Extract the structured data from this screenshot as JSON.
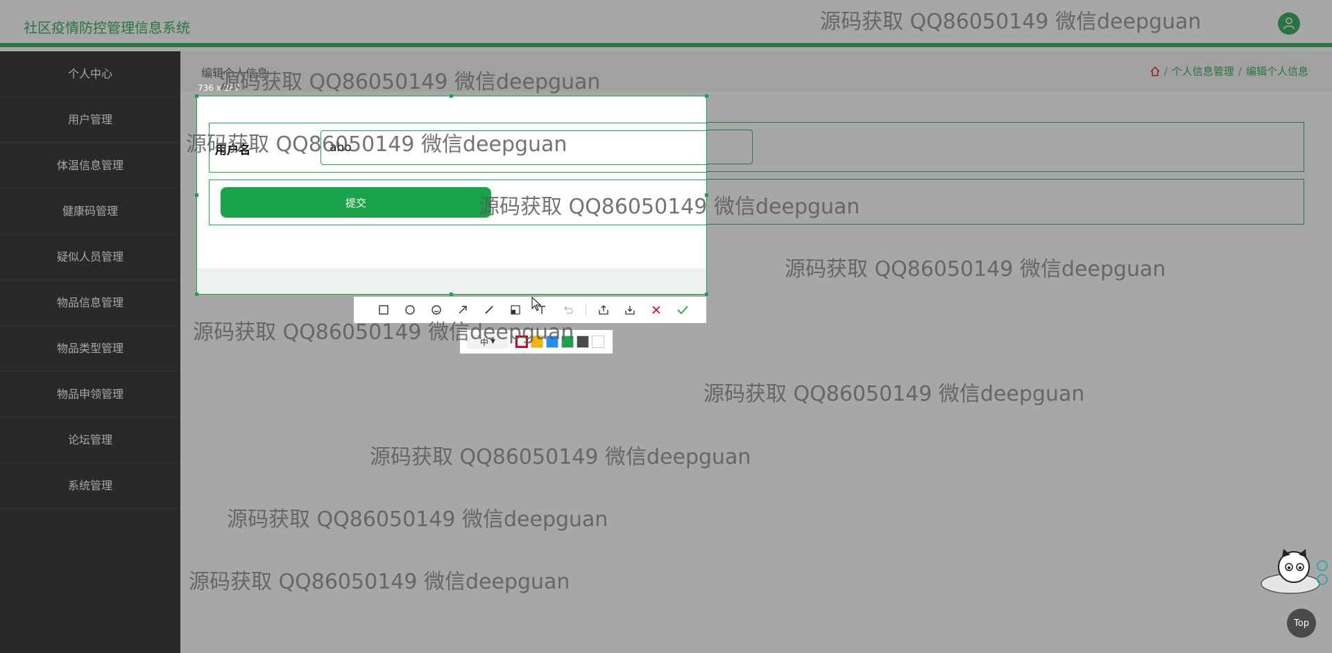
{
  "header": {
    "title": "社区疫情防控管理信息系统",
    "avatar_icon": "user-icon"
  },
  "sidebar": {
    "items": [
      {
        "label": "个人中心"
      },
      {
        "label": "用户管理"
      },
      {
        "label": "体温信息管理"
      },
      {
        "label": "健康码管理"
      },
      {
        "label": "疑似人员管理"
      },
      {
        "label": "物品信息管理"
      },
      {
        "label": "物品类型管理"
      },
      {
        "label": "物品申领管理"
      },
      {
        "label": "论坛管理"
      },
      {
        "label": "系统管理"
      }
    ]
  },
  "page": {
    "title": "编辑个人信息",
    "breadcrumb": [
      "个人信息管理",
      "编辑个人信息"
    ],
    "form": {
      "username_label": "用户名",
      "username_value": "abo",
      "submit_label": "提交"
    }
  },
  "screenshot_tool": {
    "size_label": "736 x 287",
    "tools": [
      "rectangle-icon",
      "ellipse-icon",
      "emoji-icon",
      "arrow-icon",
      "pen-icon",
      "mosaic-icon",
      "text-icon",
      "undo-icon",
      "share-icon",
      "download-icon",
      "close-icon",
      "confirm-icon"
    ],
    "size_option": "中",
    "colors": [
      "#d9001b",
      "#f5b400",
      "#1e90ff",
      "#1aa34a",
      "#4a4a4a",
      "#ffffff"
    ]
  },
  "watermark": "源码获取 QQ86050149 微信deepguan",
  "top_button": "Top",
  "colors": {
    "accent": "#1aa34a",
    "sidebar_bg": "#1a1a1a"
  }
}
